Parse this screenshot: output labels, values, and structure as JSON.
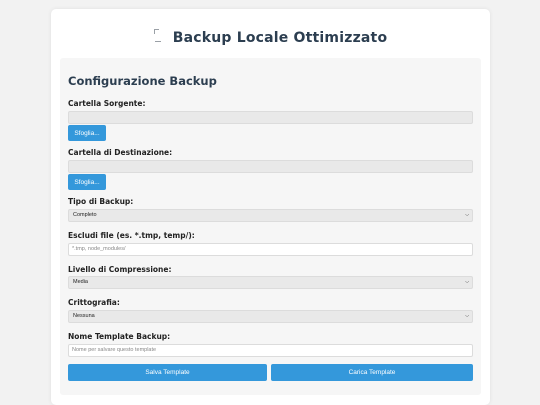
{
  "app": {
    "title": "Backup Locale Ottimizzato",
    "logo_icon": "broken-image-icon"
  },
  "config": {
    "section_title": "Configurazione Backup",
    "source": {
      "label": "Cartella Sorgente:",
      "value": "",
      "button_label": "Sfoglia..."
    },
    "destination": {
      "label": "Cartella di Destinazione:",
      "value": "",
      "button_label": "Sfoglia..."
    },
    "backup_type": {
      "label": "Tipo di Backup:",
      "selected": "Completo"
    },
    "exclude": {
      "label": "Escludi file (es. *.tmp, temp/):",
      "placeholder": "*.tmp, node_modules/"
    },
    "compression": {
      "label": "Livello di Compressione:",
      "selected": "Media"
    },
    "encryption": {
      "label": "Crittografia:",
      "selected": "Nessuna"
    },
    "template_name": {
      "label": "Nome Template Backup:",
      "placeholder": "Nome per salvare questo template"
    },
    "save_template_label": "Salva Template",
    "load_template_label": "Carica Template"
  },
  "colors": {
    "accent": "#3498db",
    "title": "#2c3e50",
    "page_bg": "#f2f2f2",
    "panel_bg": "#f6f6f6"
  }
}
